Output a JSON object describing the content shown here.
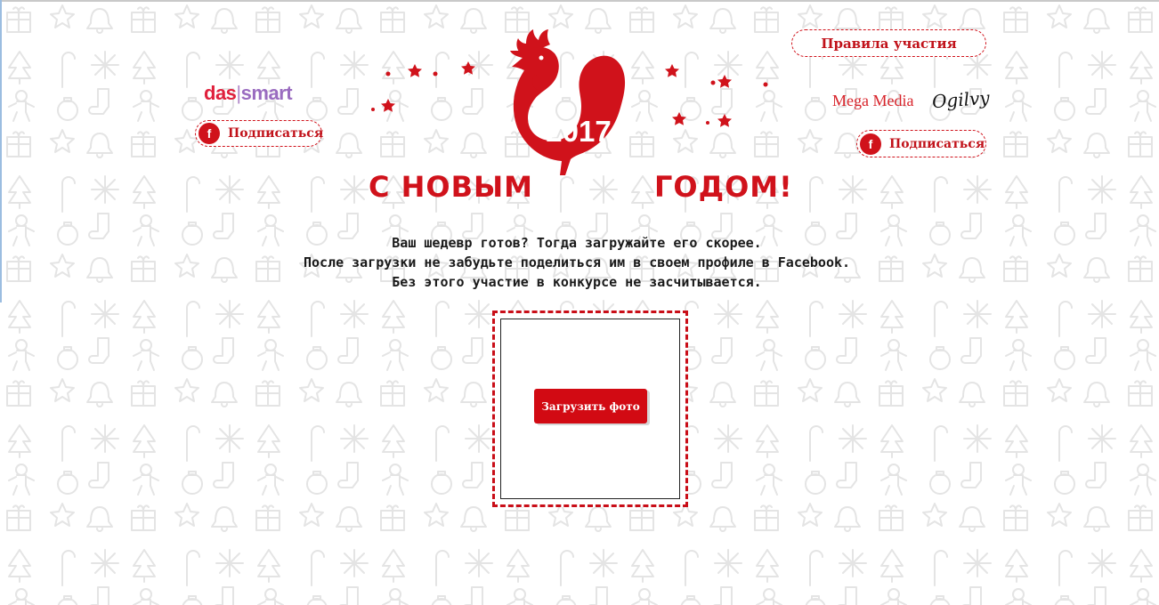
{
  "colors": {
    "brand_red": "#d0121b",
    "pattern_gray": "#e6e6e6",
    "text_dark": "#1a1a1a"
  },
  "header": {
    "left_logo": {
      "part1": "das",
      "separator": "|",
      "part2": "smart"
    },
    "right_logo": {
      "text": "Mega Media",
      "signature": "Ogilvy"
    },
    "rules_link": "Правила участия",
    "subscribe_left": "Подписаться",
    "subscribe_right": "Подписаться",
    "fb_icon": "f"
  },
  "hero": {
    "year": "2017",
    "greeting_left": "С НОВЫМ",
    "greeting_right": "ГОДОМ!",
    "emblem_icon": "rooster-icon"
  },
  "intro": {
    "line1": "Ваш шедевр готов? Тогда загружайте его скорее.",
    "line2": "После загрузки не забудьте поделиться им в своем профиле в Facebook.",
    "line3": "Без этого участие в конкурсе не засчитывается."
  },
  "upload": {
    "button_label": "Загрузить фото"
  }
}
